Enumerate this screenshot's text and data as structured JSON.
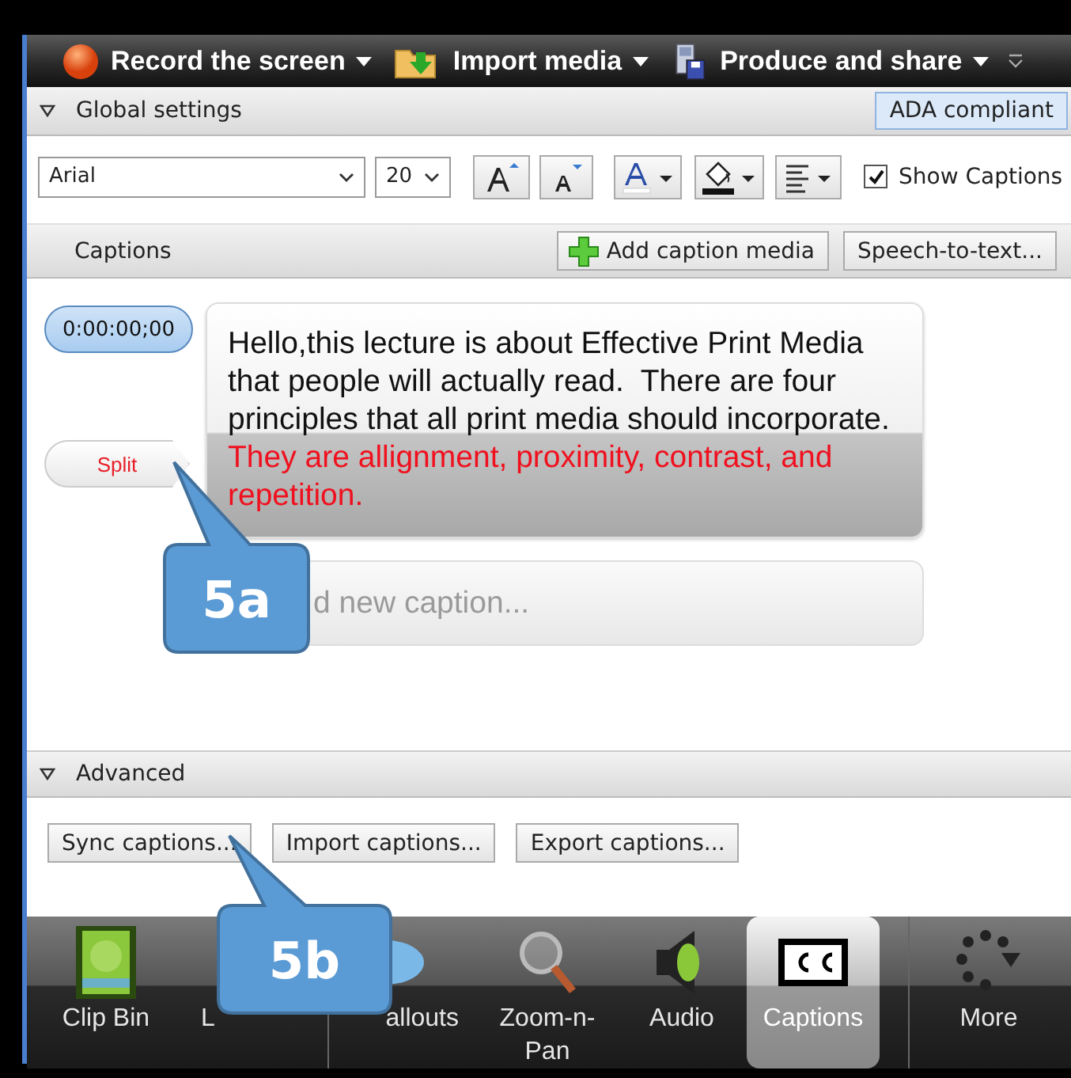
{
  "toolbar": {
    "items": [
      {
        "label": "Record the screen",
        "kind": "record"
      },
      {
        "label": "Import media",
        "kind": "import"
      },
      {
        "label": "Produce and share",
        "kind": "produce"
      }
    ]
  },
  "global_settings": {
    "title": "Global settings",
    "expanded": true,
    "ada_button": "ADA compliant"
  },
  "format_bar": {
    "font": "Arial",
    "size": "20",
    "show_captions": {
      "label": "Show Captions",
      "checked": true
    }
  },
  "captions_bar": {
    "title": "Captions",
    "add_button": "Add caption media",
    "speech_button": "Speech-to-text..."
  },
  "caption": {
    "timecode": "0:00:00;00",
    "split_button": "Split",
    "segments": [
      {
        "text": "Hello,this lecture is about Effective Print Media that people will actually read.  There are four principles that all print media should incorporate.",
        "kind": "normal"
      },
      {
        "text": "They are allignment, proximity, contrast, and repetition.",
        "kind": "highlighted"
      }
    ]
  },
  "new_caption": {
    "placeholder": "d new caption..."
  },
  "advanced": {
    "title": "Advanced",
    "expanded": true,
    "buttons": [
      "Sync captions...",
      "Import captions...",
      "Export captions..."
    ]
  },
  "tabs": [
    {
      "label": "Clip Bin",
      "kind": "clip-bin",
      "selected": false
    },
    {
      "label": "L",
      "kind": "library",
      "selected": false
    },
    {
      "label": "allouts",
      "kind": "callouts",
      "selected": false
    },
    {
      "label": "Zoom-n-\nPan",
      "kind": "zoom",
      "selected": false
    },
    {
      "label": "Audio",
      "kind": "audio",
      "selected": false
    },
    {
      "label": "Captions",
      "kind": "captions",
      "selected": true
    },
    {
      "label": "More",
      "kind": "more",
      "selected": false
    }
  ],
  "annotations": [
    {
      "label": "5a",
      "kind": "upper"
    },
    {
      "label": "5b",
      "kind": "lower"
    }
  ]
}
